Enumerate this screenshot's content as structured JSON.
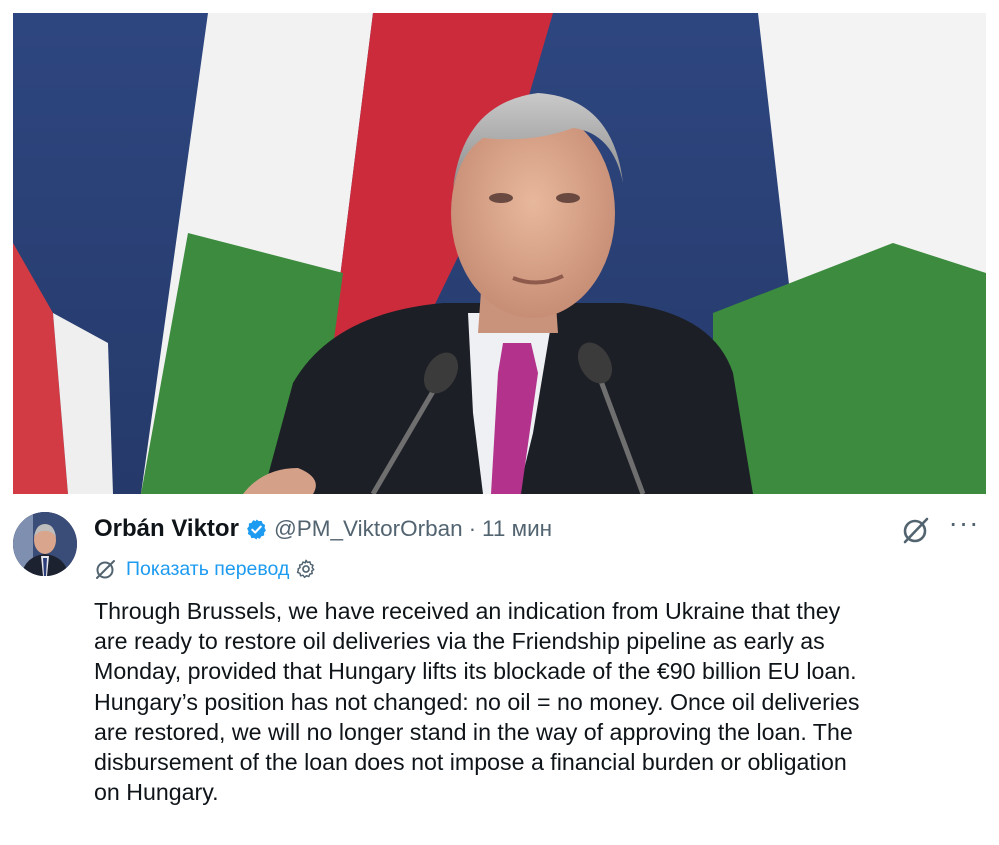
{
  "post": {
    "author_name": "Orbán Viktor",
    "handle": "@PM_ViktorOrban",
    "separator": "·",
    "time": "11 мин",
    "more_label": "···",
    "translate_label": "Показать перевод",
    "body_lines": [
      "Through Brussels, we have received an indication from Ukraine that they",
      "are ready to restore oil deliveries via the Friendship pipeline as early as",
      "Monday, provided that Hungary lifts its blockade of the €90 billion EU loan.",
      "Hungary’s position has not changed: no oil = no money. Once oil deliveries",
      "are restored, we will no longer stand in the way of approving the loan. The",
      "disbursement of the loan does not impose a financial burden or obligation",
      "on Hungary."
    ]
  },
  "colors": {
    "link": "#1d9bf0",
    "verified": "#1d9bf0",
    "muted": "#536471",
    "text": "#0f1419",
    "flag_red": "#cd2a3e",
    "flag_white": "#f4f4f4",
    "flag_green": "#3d8a3f",
    "backdrop_blue": "#30477c"
  },
  "icons": {
    "verified": "verified-badge-icon",
    "grok": "grok-icon",
    "more": "more-icon",
    "translate": "translate-icon",
    "settings": "gear-icon"
  }
}
